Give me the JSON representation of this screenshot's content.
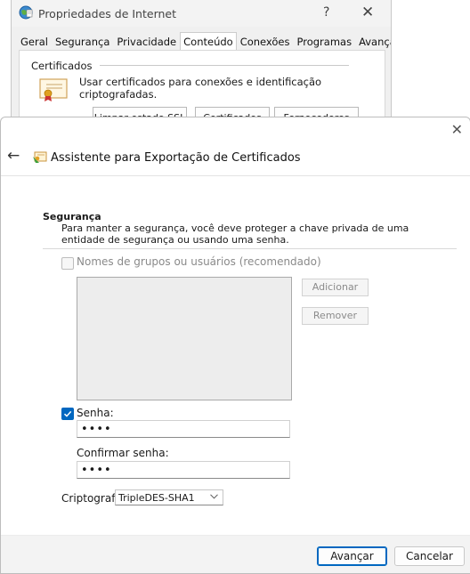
{
  "background_dialog": {
    "title": "Propriedades de Internet",
    "help_label": "?",
    "close_label": "✕",
    "tabs": [
      {
        "label": "Geral"
      },
      {
        "label": "Segurança"
      },
      {
        "label": "Privacidade"
      },
      {
        "label": "Conteúdo"
      },
      {
        "label": "Conexões"
      },
      {
        "label": "Programas"
      },
      {
        "label": "Avançado"
      }
    ],
    "active_tab": "Conteúdo",
    "group_label": "Certificados",
    "cert_description": "Usar certificados para conexões e identificação criptografadas.",
    "buttons": {
      "clear_ssl": "Limpar estado SSL",
      "certificates": "Certificados",
      "publishers": "Fornecedores"
    }
  },
  "wizard": {
    "close_label": "✕",
    "back_label": "←",
    "title": "Assistente para Exportação de Certificados",
    "section_heading": "Segurança",
    "section_description": "Para manter a segurança, você deve proteger a chave privada de uma entidade de segurança ou usando uma senha.",
    "groups_checkbox_label": "Nomes de grupos ou usuários (recomendado)",
    "groups_checked": false,
    "add_button": "Adicionar",
    "remove_button": "Remover",
    "password_checkbox_label": "Senha:",
    "password_checked": true,
    "password_value": "••••",
    "confirm_label": "Confirmar senha:",
    "confirm_value": "••••",
    "crypto_label": "Criptografia:",
    "crypto_selected": "TripleDES-SHA1",
    "next_button": "Avançar",
    "cancel_button": "Cancelar"
  },
  "colors": {
    "accent": "#0067c0",
    "footer_bg": "#f3f3f3",
    "disabled_text": "#8a8a8a"
  }
}
